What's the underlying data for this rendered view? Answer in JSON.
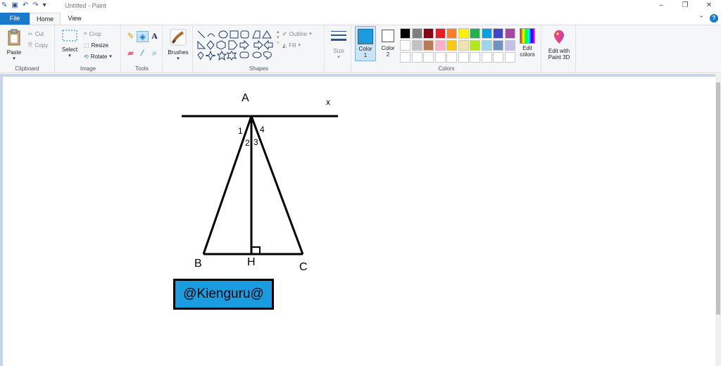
{
  "window": {
    "title": "Untitled - Paint",
    "minimize": "–",
    "restore": "❐",
    "close": "✕"
  },
  "tabs": {
    "file": "File",
    "home": "Home",
    "view": "View"
  },
  "clipboard": {
    "paste": "Paste",
    "cut": "Cut",
    "copy": "Copy",
    "label": "Clipboard"
  },
  "image": {
    "select": "Select",
    "crop": "Crop",
    "resize": "Resize",
    "rotate": "Rotate",
    "label": "Image"
  },
  "tools": {
    "label": "Tools",
    "brushes": "Brushes"
  },
  "shapes": {
    "outline": "Outline",
    "fill": "Fill",
    "label": "Shapes"
  },
  "size": {
    "label": "Size"
  },
  "colors": {
    "color1": "Color\n1",
    "color1_line1": "Color",
    "color1_line2": "1",
    "color2_line1": "Color",
    "color2_line2": "2",
    "edit_line1": "Edit",
    "edit_line2": "colors",
    "label": "Colors",
    "color1_value": "#1a9ce0",
    "color2_value": "#ffffff",
    "palette_row1": [
      "#000000",
      "#7f7f7f",
      "#880015",
      "#ed1c24",
      "#ff7f27",
      "#fff200",
      "#22b14c",
      "#00a2e8",
      "#3f48cc",
      "#a349a4"
    ],
    "palette_row2": [
      "#ffffff",
      "#c3c3c3",
      "#b97a57",
      "#ffaec9",
      "#ffc90e",
      "#efe4b0",
      "#b5e61d",
      "#99d9ea",
      "#7092be",
      "#c8bfe7"
    ],
    "palette_row3": [
      "#ffffff",
      "#ffffff",
      "#ffffff",
      "#ffffff",
      "#ffffff",
      "#ffffff",
      "#ffffff",
      "#ffffff",
      "#ffffff",
      "#ffffff"
    ]
  },
  "paint3d": {
    "line1": "Edit with",
    "line2": "Paint 3D"
  },
  "drawing": {
    "label_A": "A",
    "label_x": "x",
    "label_B": "B",
    "label_H": "H",
    "label_C": "C",
    "angle_1": "1",
    "angle_2": "2",
    "angle_3": "3",
    "angle_4": "4",
    "watermark": "@Kienguru@"
  }
}
